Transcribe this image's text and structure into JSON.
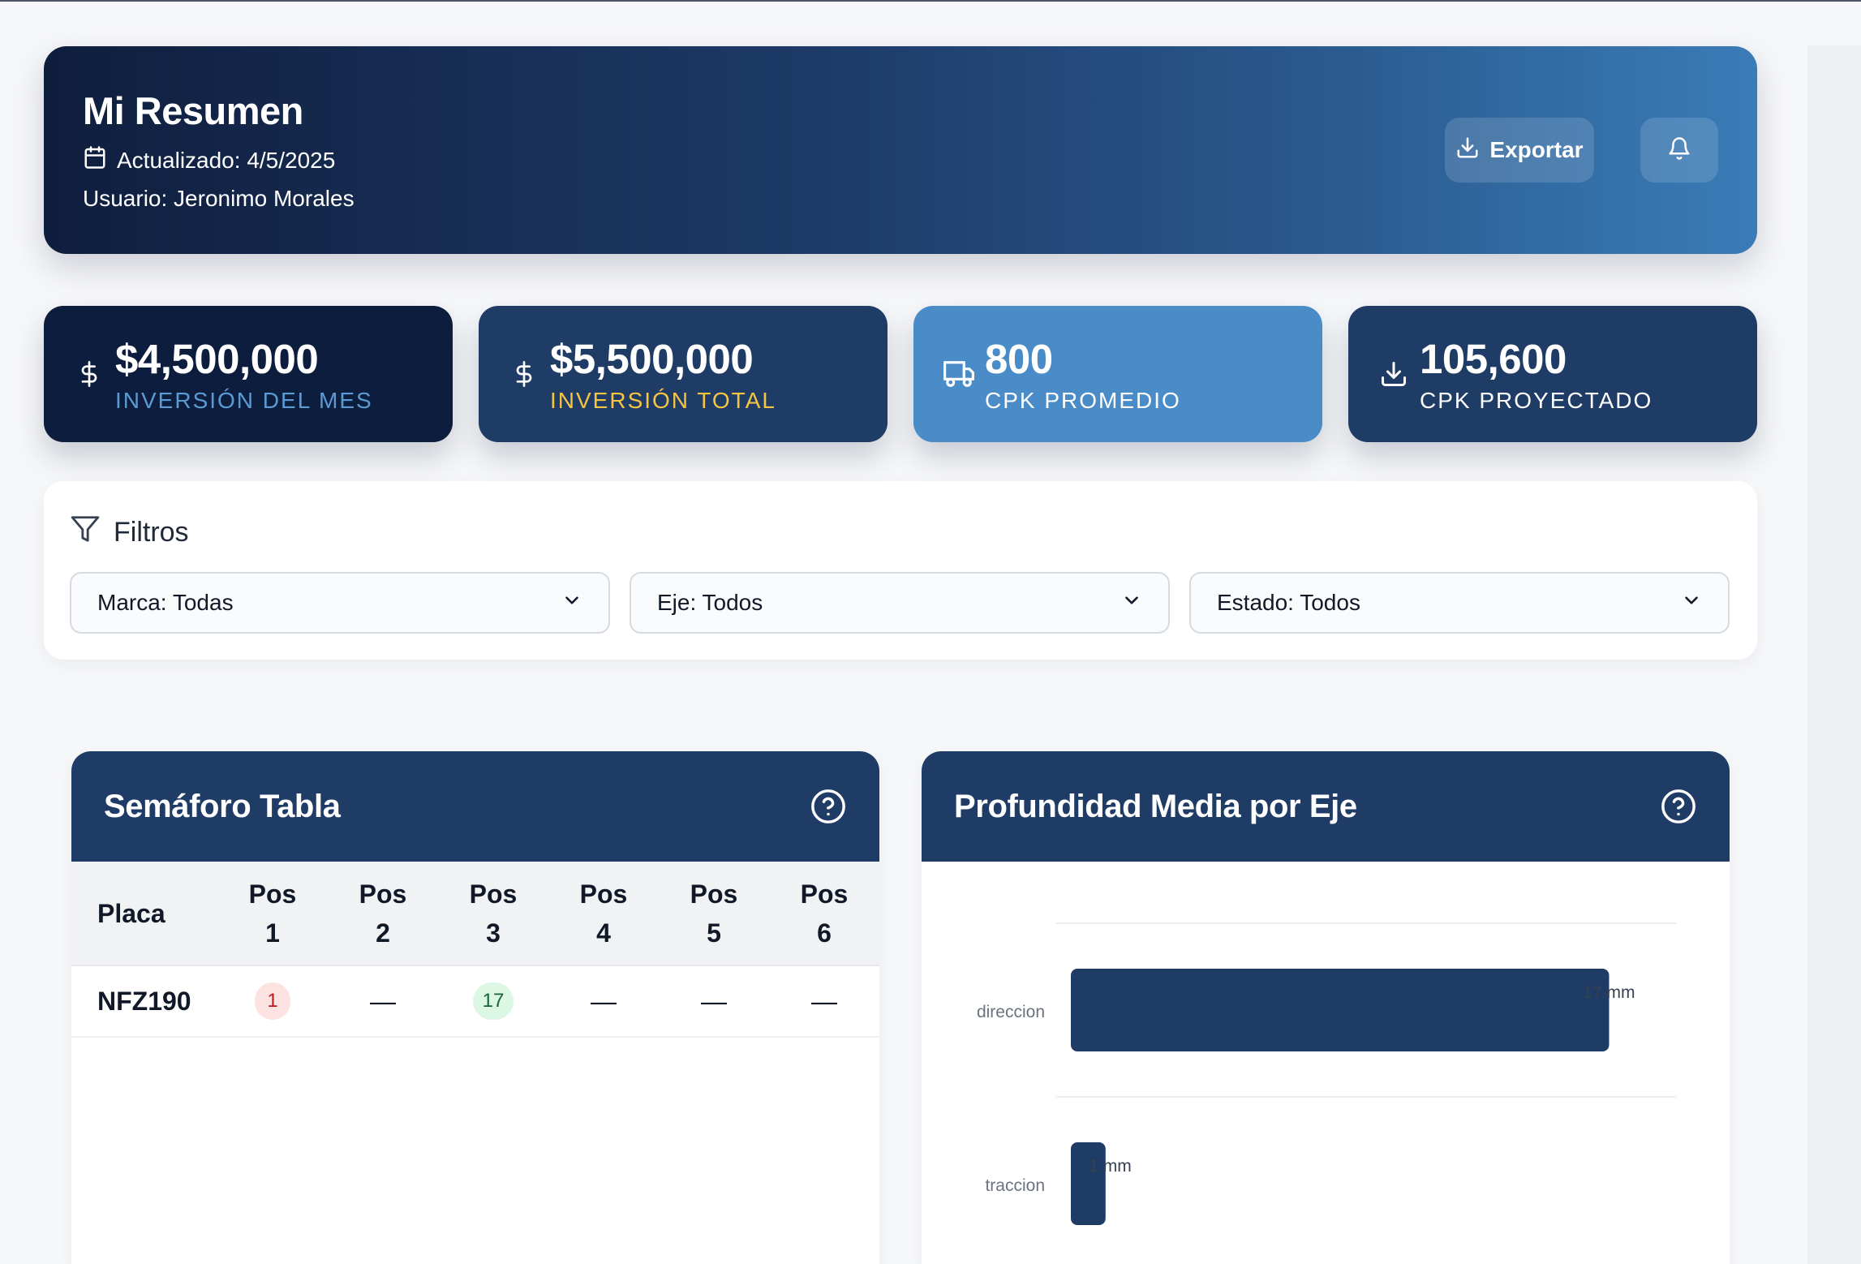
{
  "header": {
    "title": "Mi Resumen",
    "updated": "Actualizado: 4/5/2025",
    "user": "Usuario: Jeronimo Morales",
    "export_label": "Exportar"
  },
  "kpis": [
    {
      "value": "$4,500,000",
      "label": "INVERSIÓN DEL MES",
      "icon": "dollar-icon",
      "label_color": "#5b9bd5"
    },
    {
      "value": "$5,500,000",
      "label": "INVERSIÓN TOTAL",
      "icon": "dollar-icon",
      "label_color": "#f5c542"
    },
    {
      "value": "800",
      "label": "CPK PROMEDIO",
      "icon": "truck-icon",
      "label_color": "#ffffff"
    },
    {
      "value": "105,600",
      "label": "CPK PROYECTADO",
      "icon": "download-icon",
      "label_color": "#ffffff"
    }
  ],
  "filters": {
    "title": "Filtros",
    "selects": [
      {
        "value": "Marca: Todas"
      },
      {
        "value": "Eje: Todos"
      },
      {
        "value": "Estado: Todos"
      }
    ]
  },
  "semaforo": {
    "title": "Semáforo Tabla",
    "columns": [
      "Placa",
      "Pos 1",
      "Pos 2",
      "Pos 3",
      "Pos 4",
      "Pos 5",
      "Pos 6"
    ],
    "rows": [
      {
        "placa": "NFZ190",
        "cells": [
          "1",
          "—",
          "17",
          "—",
          "—",
          "—"
        ]
      }
    ],
    "status_colors": {
      "red": "#fde2e2",
      "green": "#dcf7e3"
    }
  },
  "depth_panel": {
    "title": "Profundidad Media por Eje"
  },
  "chart_data": {
    "type": "bar",
    "orientation": "horizontal",
    "categories": [
      "direccion",
      "traccion"
    ],
    "values": [
      17,
      1
    ],
    "value_labels": [
      "17 mm",
      "1 mm"
    ],
    "unit": "mm",
    "xlim": [
      0,
      18
    ],
    "grid": true,
    "bar_color": "#1f3c66"
  }
}
